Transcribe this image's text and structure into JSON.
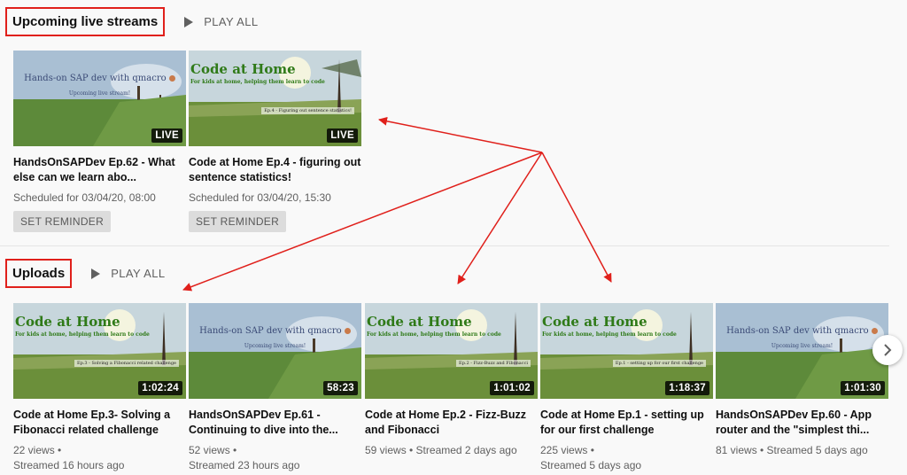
{
  "upcoming": {
    "title": "Upcoming live streams",
    "play_all": "PLAY ALL",
    "videos": [
      {
        "title": "HandsOnSAPDev Ep.62 - What else can we learn abo...",
        "badge": "LIVE",
        "meta1": "Scheduled for 03/04/20, 08:00",
        "button": "SET REMINDER",
        "thumb": "sap",
        "overlay": "Hands-on SAP dev with qmacro",
        "overlay_sub": "Upcoming live stream!"
      },
      {
        "title": "Code at Home Ep.4 - figuring out sentence statistics!",
        "badge": "LIVE",
        "meta1": "Scheduled for 03/04/20, 15:30",
        "button": "SET REMINDER",
        "thumb": "cah",
        "overlay": "Code at Home",
        "overlay_sub": "For kids at home, helping them learn to code",
        "caption": "Ep.4 - Figuring out sentence statistics!"
      }
    ]
  },
  "uploads": {
    "title": "Uploads",
    "play_all": "PLAY ALL",
    "videos": [
      {
        "title": "Code at Home Ep.3- Solving a Fibonacci related challenge",
        "badge": "1:02:24",
        "meta1": "22 views •",
        "meta2": "Streamed 16 hours ago",
        "thumb": "cah",
        "overlay": "Code at Home",
        "overlay_sub": "For kids at home, helping them learn to code",
        "caption": "Ep.3 - Solving a Fibonacci related challenge"
      },
      {
        "title": "HandsOnSAPDev Ep.61 - Continuing to dive into the...",
        "badge": "58:23",
        "meta1": "52 views •",
        "meta2": "Streamed 23 hours ago",
        "thumb": "sap",
        "overlay": "Hands-on SAP dev with qmacro",
        "overlay_sub": "Upcoming live stream!"
      },
      {
        "title": "Code at Home Ep.2 - Fizz-Buzz and Fibonacci",
        "badge": "1:01:02",
        "meta1": "59 views • Streamed 2 days ago",
        "meta2": "",
        "thumb": "cah",
        "overlay": "Code at Home",
        "overlay_sub": "For kids at home, helping them learn to code",
        "caption": "Ep.2 - Fizz-Buzz and Fibonacci"
      },
      {
        "title": "Code at Home Ep.1 - setting up for our first challenge",
        "badge": "1:18:37",
        "meta1": "225 views •",
        "meta2": "Streamed 5 days ago",
        "thumb": "cah",
        "overlay": "Code at Home",
        "overlay_sub": "For kids at home, helping them learn to code",
        "caption": "Ep.1 - setting up for our first challenge"
      },
      {
        "title": "HandsOnSAPDev Ep.60 - App router and the \"simplest thi...",
        "badge": "1:01:30",
        "meta1": "81 views • Streamed 5 days ago",
        "meta2": "",
        "thumb": "sap",
        "overlay": "Hands-on SAP dev with qmacro",
        "overlay_sub": "Upcoming live stream!"
      }
    ]
  },
  "colors": {
    "highlight": "#e0201b",
    "arrow": "#e0201b",
    "text_secondary": "#606060"
  },
  "icons": {
    "play_all": "play-triangle-icon",
    "next": "chevron-right-icon"
  }
}
